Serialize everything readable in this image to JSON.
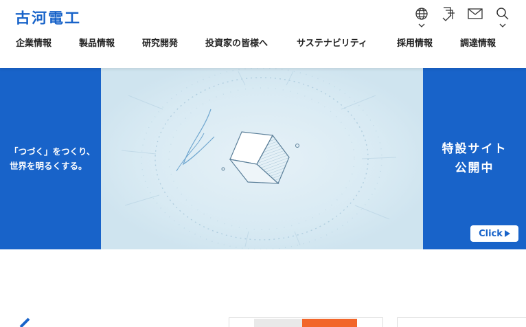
{
  "header": {
    "logo_text": "古河電工",
    "icons": [
      "globe-icon",
      "document-icon",
      "mail-icon",
      "search-icon"
    ]
  },
  "nav": {
    "items": [
      {
        "label": "企業情報"
      },
      {
        "label": "製品情報"
      },
      {
        "label": "研究開発"
      },
      {
        "label": "投資家の皆様へ"
      },
      {
        "label": "サステナビリティ"
      },
      {
        "label": "採用情報"
      },
      {
        "label": "調達情報"
      }
    ]
  },
  "banner": {
    "left_line1": "「つづく」をつくり、",
    "left_line2": "世界を明るくする。",
    "right_line1": "特設サイト",
    "right_line2": "公開中",
    "click_label": "Click"
  },
  "colors": {
    "brand": "#1863c9",
    "banner_bg": "#d5e8f2"
  }
}
